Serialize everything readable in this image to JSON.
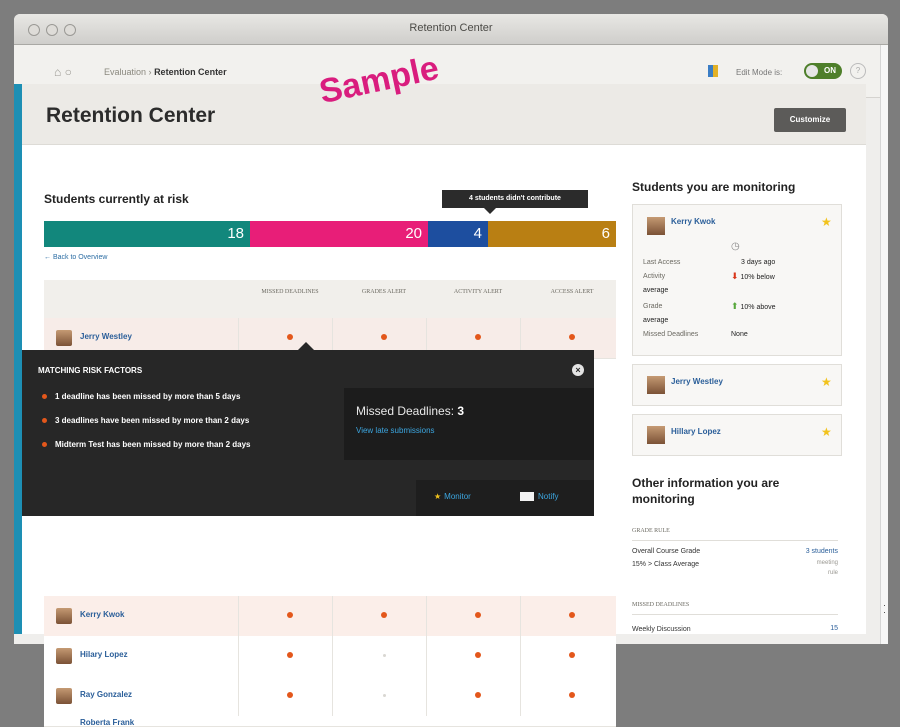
{
  "window": {
    "title": "Retention Center"
  },
  "breadcrumb": {
    "parent": "Evaluation",
    "separator": "›",
    "current": "Retention Center"
  },
  "edit_mode": {
    "label": "Edit Mode is:",
    "state": "ON"
  },
  "page": {
    "title": "Retention Center",
    "customize_label": "Customize",
    "watermark": "Sample"
  },
  "risk": {
    "title": "Students currently at risk",
    "tooltip": "4 students didn't contribute",
    "back_link": "← Back to Overview",
    "segments": [
      {
        "value": "18",
        "color": "#12877c"
      },
      {
        "value": "20",
        "color": "#e81e78"
      },
      {
        "value": "4",
        "color": "#1d4e9f"
      },
      {
        "value": "6",
        "color": "#b97f13"
      }
    ],
    "columns": [
      "MISSED DEADLINES",
      "GRADES ALERT",
      "ACTIVITY ALERT",
      "ACCESS ALERT"
    ],
    "students": [
      {
        "name": "Jerry Westley"
      },
      {
        "name": "Kerry Kwok"
      },
      {
        "name": "Hilary Lopez"
      },
      {
        "name": "Ray Gonzalez"
      },
      {
        "name": "Roberta Frank"
      }
    ]
  },
  "risk_popup": {
    "title": "MATCHING RISK FACTORS",
    "items": [
      "1 deadline has been missed by more than 5 days",
      "3 deadlines have been missed by more than 2 days",
      "Midterm Test has been missed by more than 2 days"
    ],
    "missed_label": "Missed Deadlines:",
    "missed_count": "3",
    "view_link": "View late submissions",
    "monitor_label": "Monitor",
    "notify_label": "Notify"
  },
  "monitoring": {
    "title": "Students you are monitoring",
    "cards": [
      {
        "name": "Kerry Kwok"
      },
      {
        "name": "Jerry Westley"
      },
      {
        "name": "Hillary Lopez"
      }
    ],
    "details": {
      "last_access_label": "Last Access",
      "last_access": "3 days ago",
      "activity_label": "Activity",
      "activity": "10% below",
      "activity_avg": "average",
      "grade_label": "Grade",
      "grade": "10% above",
      "grade_avg": "average",
      "missed_label": "Missed Deadlines",
      "missed": "None"
    }
  },
  "other": {
    "title_line1": "Other information you are",
    "title_line2": "monitoring",
    "grade_rule_heading": "GRADE RULE",
    "grade_rule_label": "Overall Course Grade",
    "grade_rule_desc": "15% > Class Average",
    "grade_rule_link": "3 students",
    "grade_rule_meeting": "meeting",
    "grade_rule_rule": "rule",
    "missed_heading": "MISSED DEADLINES",
    "missed_label": "Weekly Discussion",
    "missed_link": "15"
  }
}
